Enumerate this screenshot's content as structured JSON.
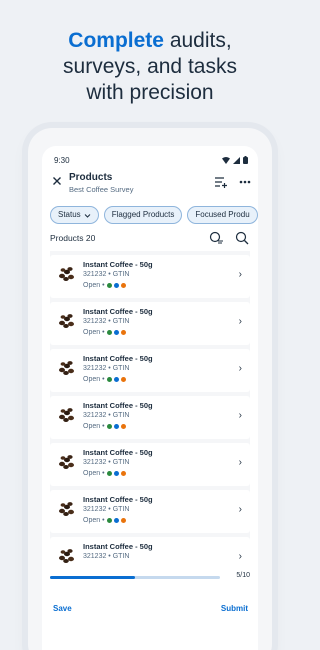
{
  "headline": {
    "accent": "Complete",
    "rest_line1": " audits,",
    "line2": "surveys, and tasks",
    "line3": "with precision"
  },
  "statusbar": {
    "time": "9:30"
  },
  "appbar": {
    "title": "Products",
    "subtitle": "Best Coffee Survey"
  },
  "chips": [
    {
      "label": "Status"
    },
    {
      "label": "Flagged Products"
    },
    {
      "label": "Focused Produ"
    }
  ],
  "list": {
    "count_label": "Products 20",
    "items": [
      {
        "name": "Instant Coffee - 50g",
        "code": "321232 • GTIN",
        "status": "Open •"
      },
      {
        "name": "Instant Coffee - 50g",
        "code": "321232 • GTIN",
        "status": "Open •"
      },
      {
        "name": "Instant Coffee - 50g",
        "code": "321232 • GTIN",
        "status": "Open •"
      },
      {
        "name": "Instant Coffee - 50g",
        "code": "321232 • GTIN",
        "status": "Open •"
      },
      {
        "name": "Instant Coffee - 50g",
        "code": "321232 • GTIN",
        "status": "Open •"
      },
      {
        "name": "Instant Coffee - 50g",
        "code": "321232 • GTIN",
        "status": "Open •"
      },
      {
        "name": "Instant Coffee - 50g",
        "code": "321232 • GTIN",
        "status": ""
      }
    ],
    "status_dot_colors": [
      "#2b8a3e",
      "#0a6ed1",
      "#e9730c"
    ]
  },
  "progress": {
    "value": 0.5,
    "label": "5/10"
  },
  "footer": {
    "save_label": "Save",
    "submit_label": "Submit"
  },
  "colors": {
    "accent": "#0a6ed1",
    "text": "#1d2d3e",
    "chip_bg": "#e8f1fa"
  },
  "icons": [
    "close-icon",
    "filter-add-icon",
    "more-icon",
    "chevron-down-icon",
    "chevron-right-icon",
    "wifi-icon",
    "signal-icon",
    "battery-icon"
  ]
}
